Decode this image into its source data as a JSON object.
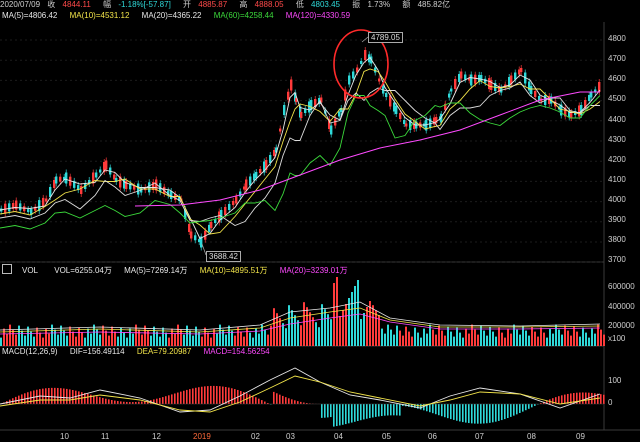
{
  "header": {
    "date": "2020/07/09",
    "close_label": "收",
    "close_value": "4844.11",
    "change_label": "幅",
    "change_value": "-1.18%[-57.87]",
    "open_label": "开",
    "open_value": "4885.87",
    "high_label": "高",
    "high_value": "4888.05",
    "low_label": "低",
    "low_value": "4803.45",
    "amplitude_label": "振",
    "amplitude_value": "1.73%",
    "turnover_label": "额",
    "turnover_value": "485.82亿"
  },
  "ma_legend": {
    "ma5": "MA(5)=4806.42",
    "ma10": "MA(10)=4531.12",
    "ma20": "MA(20)=4365.22",
    "ma60": "MA(60)=4258.44",
    "ma120": "MA(120)=4330.59"
  },
  "price_axis": [
    "4800",
    "4700",
    "4600",
    "4500",
    "4400",
    "4300",
    "4200",
    "4100",
    "4000",
    "3900",
    "3800",
    "3700"
  ],
  "callouts": {
    "high": "4789.05",
    "low": "3688.42"
  },
  "vol_legend": {
    "name": "VOL",
    "vol": "VOL=6255.04万",
    "ma5": "MA(5)=7269.14万",
    "ma10": "MA(10)=4895.51万",
    "ma20": "MA(20)=3239.01万"
  },
  "vol_axis": [
    "600000",
    "400000",
    "200000",
    "x100"
  ],
  "macd_legend": {
    "name": "MACD(12,26,9)",
    "dif": "DIF=156.49114",
    "dea": "DEA=79.20987",
    "macd": "MACD=154.56254"
  },
  "macd_axis": [
    "100",
    "0"
  ],
  "date_axis": [
    "10",
    "11",
    "12",
    "2019",
    "02",
    "03",
    "04",
    "05",
    "06",
    "07",
    "08",
    "09"
  ],
  "colors": {
    "up": "#ff3b3b",
    "down": "#2fd9d9",
    "ma5": "#e8e8e8",
    "ma10": "#f2e44a",
    "ma20": "#ff4aff",
    "ma60": "#3bd93b",
    "ma120": "#ff4aff",
    "highlight_circle": "#ff2a2a"
  },
  "icons": {
    "vol_panel": "panel-toggle-icon"
  }
}
